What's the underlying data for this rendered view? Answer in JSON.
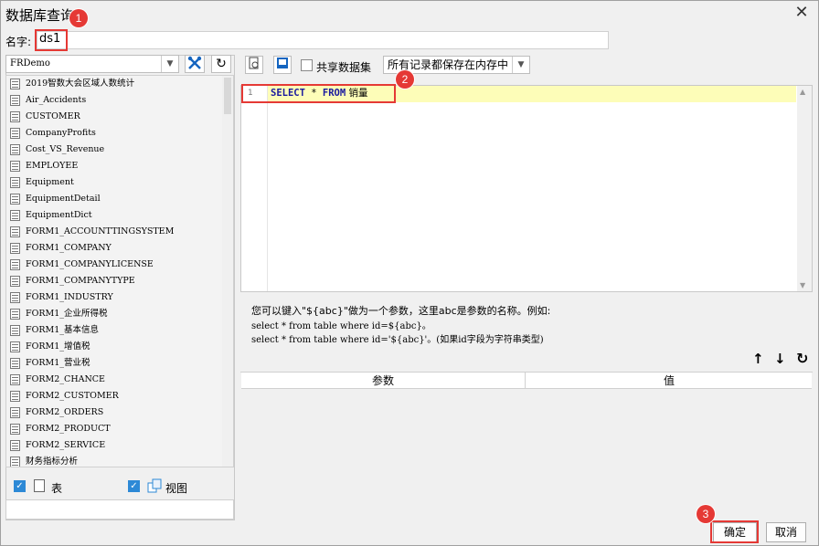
{
  "window": {
    "title": "数据库查询",
    "close_glyph": "✕"
  },
  "name_field": {
    "label": "名字:",
    "value": "ds1"
  },
  "datasource": {
    "selected": "FRDemo"
  },
  "tables": [
    "2019智数大会区域人数统计",
    "Air_Accidents",
    "CUSTOMER",
    "CompanyProfits",
    "Cost_VS_Revenue",
    "EMPLOYEE",
    "Equipment",
    "EquipmentDetail",
    "EquipmentDict",
    "FORM1_ACCOUNTTINGSYSTEM",
    "FORM1_COMPANY",
    "FORM1_COMPANYLICENSE",
    "FORM1_COMPANYTYPE",
    "FORM1_INDUSTRY",
    "FORM1_企业所得税",
    "FORM1_基本信息",
    "FORM1_增值税",
    "FORM1_营业税",
    "FORM2_CHANCE",
    "FORM2_CUSTOMER",
    "FORM2_ORDERS",
    "FORM2_PRODUCT",
    "FORM2_SERVICE",
    "财务指标分析"
  ],
  "filters": {
    "table_label": "表",
    "view_label": "视图"
  },
  "toolbar": {
    "share_label": "共享数据集",
    "save_mode": "所有记录都保存在内存中"
  },
  "editor": {
    "line_number": "1",
    "sql_select": "SELECT",
    "sql_star": " * ",
    "sql_from": "FROM",
    "sql_table": " 销量"
  },
  "hints": {
    "line1": "您可以键入\"${abc}\"做为一个参数，这里abc是参数的名称。例如:",
    "line2": "select * from table where id=${abc}。",
    "line3": "select * from table where id='${abc}'。(如果id字段为字符串类型)"
  },
  "params": {
    "col_param": "参数",
    "col_value": "值"
  },
  "buttons": {
    "ok": "确定",
    "cancel": "取消"
  },
  "badges": {
    "b1": "1",
    "b2": "2",
    "b3": "3"
  },
  "colors": {
    "accent_red": "#e53935",
    "keyword": "#1a1a9e",
    "highlight": "#fdfdb8",
    "check_blue": "#2d89d6"
  }
}
